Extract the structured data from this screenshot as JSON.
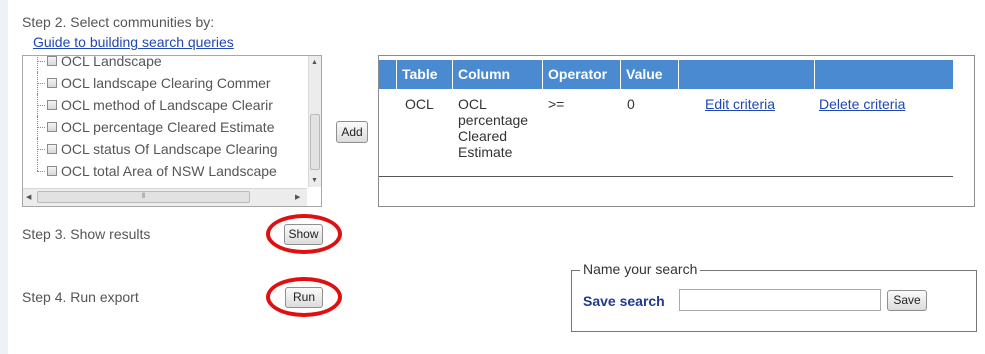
{
  "step2": {
    "title": "Step 2. Select communities by:",
    "guide_link": "Guide to building search queries",
    "tree_items": [
      {
        "label": "OCL Landscape"
      },
      {
        "label": "OCL landscape Clearing Commer"
      },
      {
        "label": "OCL method of Landscape Clearir"
      },
      {
        "label": "OCL percentage Cleared Estimate"
      },
      {
        "label": "OCL status Of Landscape Clearing"
      },
      {
        "label": "OCL total Area of NSW Landscape"
      }
    ],
    "add_label": "Add"
  },
  "criteria_table": {
    "headers": [
      "Table",
      "Column",
      "Operator",
      "Value",
      "",
      ""
    ],
    "rows": [
      {
        "table": "OCL",
        "column": "OCL percentage Cleared Estimate",
        "operator": ">=",
        "value": "0",
        "edit": "Edit criteria",
        "delete": "Delete criteria"
      }
    ]
  },
  "step3": {
    "label": "Step 3. Show results",
    "button": "Show"
  },
  "step4": {
    "label": "Step 4. Run export",
    "button": "Run"
  },
  "save": {
    "legend": "Name your search",
    "label": "Save search",
    "input_value": "",
    "button": "Save"
  },
  "colors": {
    "header_bg": "#4a8ad0",
    "link": "#1f47b3",
    "highlight_ring": "#e01010"
  }
}
